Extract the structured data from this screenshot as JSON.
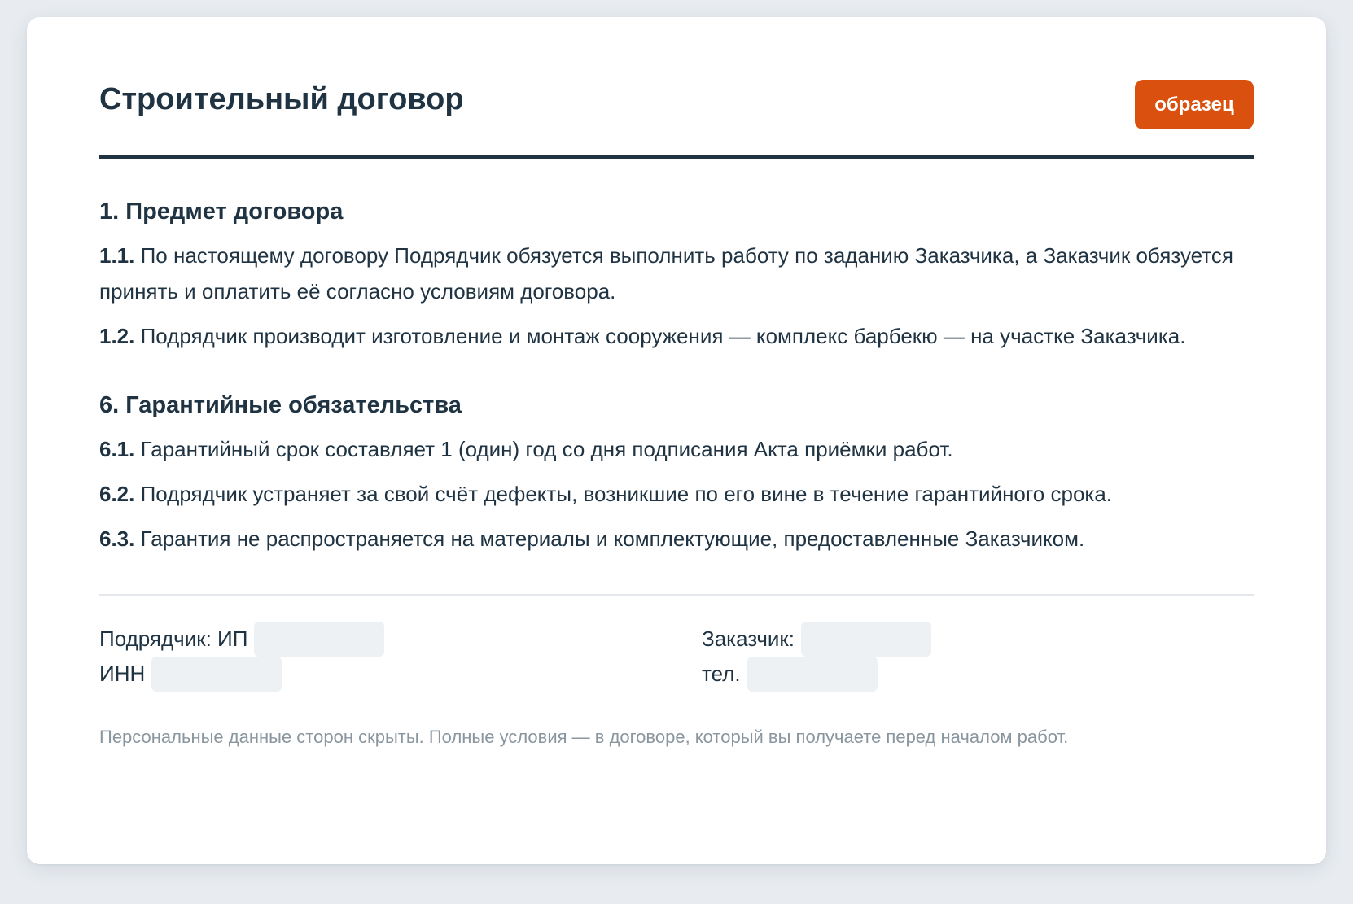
{
  "document": {
    "title": "Строительный договор",
    "badge": "образец"
  },
  "sections": [
    {
      "heading": "1. Предмет договора",
      "clauses": [
        {
          "num": "1.1.",
          "text": "По настоящему договору Подрядчик обязуется выполнить работу по заданию Заказчика, а Заказчик обязуется принять и оплатить её согласно условиям договора."
        },
        {
          "num": "1.2.",
          "text": "Подрядчик производит изготовление и монтаж сооружения — комплекс барбекю — на участке Заказчика."
        }
      ]
    },
    {
      "heading": "6. Гарантийные обязательства",
      "clauses": [
        {
          "num": "6.1.",
          "text": "Гарантийный срок составляет 1 (один) год со дня подписания Акта приёмки работ."
        },
        {
          "num": "6.2.",
          "text": "Подрядчик устраняет за свой счёт дефекты, возникшие по его вине в течение гарантийного срока."
        },
        {
          "num": "6.3.",
          "text": "Гарантия не распространяется на материалы и комплектующие, предоставленные Заказчиком."
        }
      ]
    }
  ],
  "parties": {
    "contractor": {
      "label": "Подрядчик: ИП",
      "inn_label": "ИНН"
    },
    "customer": {
      "label": "Заказчик:",
      "phone_label": "тел."
    }
  },
  "footnote": "Персональные данные сторон скрыты. Полные условия — в договоре, который вы получаете перед началом работ.",
  "colors": {
    "text": "#1f3342",
    "accent": "#d9500f",
    "muted": "#8a969f",
    "redaction": "#eef1f4"
  }
}
